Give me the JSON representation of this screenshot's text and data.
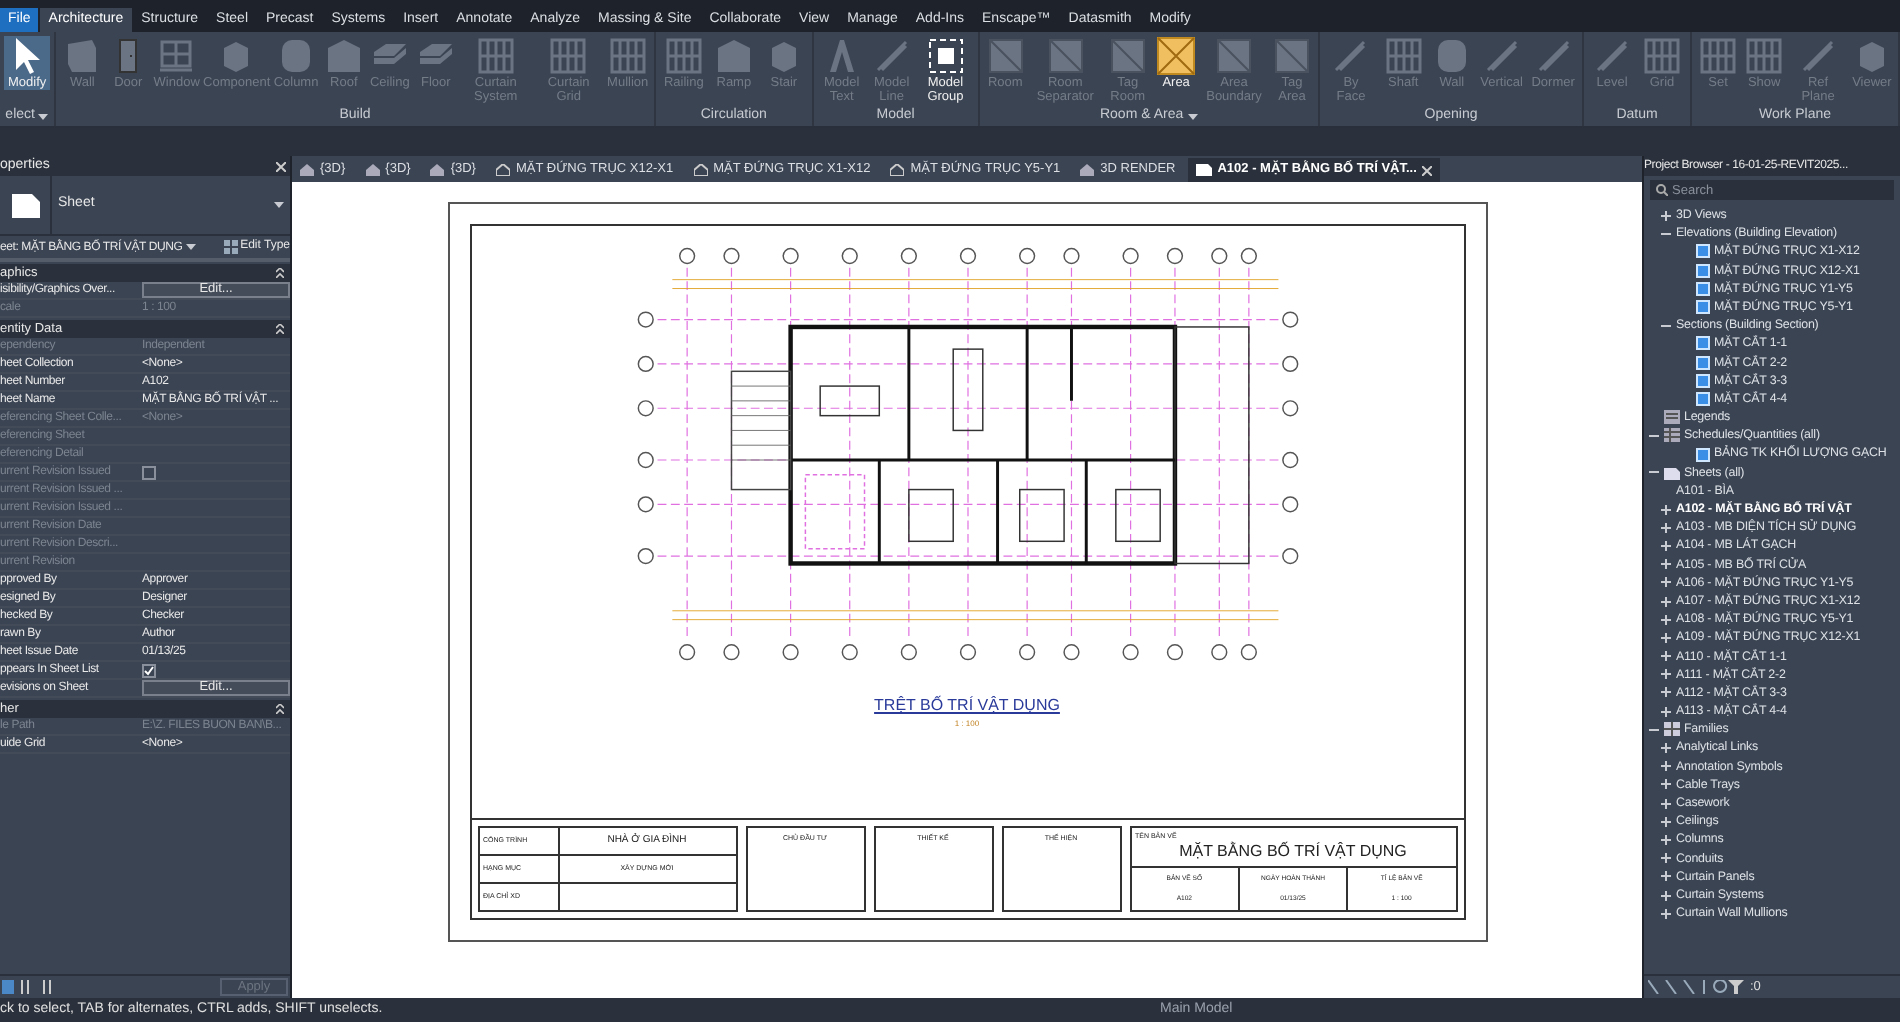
{
  "menu_tabs": [
    {
      "label": "File",
      "selected": false,
      "kind": "file"
    },
    {
      "label": "Architecture",
      "selected": true
    },
    {
      "label": "Structure",
      "selected": false
    },
    {
      "label": "Steel",
      "selected": false
    },
    {
      "label": "Precast",
      "selected": false
    },
    {
      "label": "Systems",
      "selected": false
    },
    {
      "label": "Insert",
      "selected": false
    },
    {
      "label": "Annotate",
      "selected": false
    },
    {
      "label": "Analyze",
      "selected": false
    },
    {
      "label": "Massing & Site",
      "selected": false
    },
    {
      "label": "Collaborate",
      "selected": false
    },
    {
      "label": "View",
      "selected": false
    },
    {
      "label": "Manage",
      "selected": false
    },
    {
      "label": "Add-Ins",
      "selected": false
    },
    {
      "label": "Enscape™",
      "selected": false
    },
    {
      "label": "Datasmith",
      "selected": false
    },
    {
      "label": "Modify",
      "selected": false
    }
  ],
  "ribbon_panels": [
    {
      "title": "elect",
      "dropdown": true,
      "tools": [
        {
          "label": "Modify",
          "disabled": false,
          "kind": "pointer",
          "selected": true
        }
      ]
    },
    {
      "title": "Build",
      "dropdown": false,
      "tools": [
        {
          "label": "Wall",
          "disabled": true,
          "kind": "wall"
        },
        {
          "label": "Door",
          "disabled": true,
          "kind": "door"
        },
        {
          "label": "Window",
          "disabled": true,
          "kind": "window"
        },
        {
          "label": "Component",
          "disabled": true,
          "kind": "box"
        },
        {
          "label": "Column",
          "disabled": true,
          "kind": "column"
        },
        {
          "label": "Roof",
          "disabled": true,
          "kind": "roof"
        },
        {
          "label": "Ceiling",
          "disabled": true,
          "kind": "slab"
        },
        {
          "label": "Floor",
          "disabled": true,
          "kind": "slab"
        },
        {
          "label": "Curtain System",
          "disabled": true,
          "kind": "grid"
        },
        {
          "label": "Curtain Grid",
          "disabled": true,
          "kind": "grid"
        },
        {
          "label": "Mullion",
          "disabled": true,
          "kind": "grid"
        }
      ]
    },
    {
      "title": "Circulation",
      "dropdown": false,
      "tools": [
        {
          "label": "Railing",
          "disabled": true,
          "kind": "grid"
        },
        {
          "label": "Ramp",
          "disabled": true,
          "kind": "roof"
        },
        {
          "label": "Stair",
          "disabled": true,
          "kind": "box"
        }
      ]
    },
    {
      "title": "Model",
      "dropdown": false,
      "tools": [
        {
          "label": "Model Text",
          "disabled": true,
          "kind": "letter"
        },
        {
          "label": "Model Line",
          "disabled": true,
          "kind": "line"
        },
        {
          "label": "Model Group",
          "disabled": false,
          "kind": "group"
        }
      ]
    },
    {
      "title": "Room & Area",
      "dropdown": true,
      "tools": [
        {
          "label": "Room",
          "disabled": true,
          "kind": "room"
        },
        {
          "label": "Room Separator",
          "disabled": true,
          "kind": "room"
        },
        {
          "label": "Tag Room",
          "disabled": true,
          "kind": "room"
        },
        {
          "label": "Area",
          "disabled": false,
          "kind": "area"
        },
        {
          "label": "Area Boundary",
          "disabled": true,
          "kind": "room"
        },
        {
          "label": "Tag Area",
          "disabled": true,
          "kind": "room"
        }
      ]
    },
    {
      "title": "Opening",
      "dropdown": false,
      "tools": [
        {
          "label": "By Face",
          "disabled": true,
          "kind": "line"
        },
        {
          "label": "Shaft",
          "disabled": true,
          "kind": "grid"
        },
        {
          "label": "Wall",
          "disabled": true,
          "kind": "column"
        },
        {
          "label": "Vertical",
          "disabled": true,
          "kind": "line"
        },
        {
          "label": "Dormer",
          "disabled": true,
          "kind": "line"
        }
      ]
    },
    {
      "title": "Datum",
      "dropdown": false,
      "tools": [
        {
          "label": "Level",
          "disabled": true,
          "kind": "line"
        },
        {
          "label": "Grid",
          "disabled": true,
          "kind": "grid"
        }
      ]
    },
    {
      "title": "Work Plane",
      "dropdown": false,
      "tools": [
        {
          "label": "Set",
          "disabled": true,
          "kind": "grid"
        },
        {
          "label": "Show",
          "disabled": true,
          "kind": "grid"
        },
        {
          "label": "Ref Plane",
          "disabled": true,
          "kind": "line"
        },
        {
          "label": "Viewer",
          "disabled": true,
          "kind": "box"
        }
      ]
    }
  ],
  "properties": {
    "title": "operties",
    "type_name": "Sheet",
    "selector": "eet: MẶT BẰNG BỐ TRÍ VẬT DỤNG",
    "edit_type": "Edit Type",
    "groups": [
      {
        "title": "aphics",
        "rows": [
          {
            "label": "isibility/Graphics Over...",
            "value": "Edit...",
            "kind": "button",
            "disabled": false
          },
          {
            "label": "cale",
            "value": "1 : 100",
            "kind": "text",
            "disabled": true
          }
        ]
      },
      {
        "title": "entity Data",
        "rows": [
          {
            "label": "ependency",
            "value": "Independent",
            "kind": "text",
            "disabled": true
          },
          {
            "label": "heet Collection",
            "value": "<None>",
            "kind": "text",
            "disabled": false
          },
          {
            "label": "heet Number",
            "value": "A102",
            "kind": "text",
            "disabled": false
          },
          {
            "label": "heet Name",
            "value": "MẶT BẰNG BỐ TRÍ VẬT ...",
            "kind": "text",
            "disabled": false
          },
          {
            "label": "eferencing Sheet Colle...",
            "value": "<None>",
            "kind": "text",
            "disabled": true
          },
          {
            "label": "eferencing Sheet",
            "kind": "text",
            "disabled": true
          },
          {
            "label": "eferencing Detail",
            "kind": "text",
            "disabled": true
          },
          {
            "label": "urrent Revision Issued",
            "kind": "checkbox",
            "checked": false,
            "disabled": true
          },
          {
            "label": "urrent Revision Issued ...",
            "kind": "text",
            "disabled": true
          },
          {
            "label": "urrent Revision Issued ...",
            "kind": "text",
            "disabled": true
          },
          {
            "label": "urrent Revision Date",
            "kind": "text",
            "disabled": true
          },
          {
            "label": "urrent Revision Descri...",
            "kind": "text",
            "disabled": true
          },
          {
            "label": "urrent Revision",
            "kind": "text",
            "disabled": true
          },
          {
            "label": "pproved By",
            "value": "Approver",
            "kind": "text",
            "disabled": false
          },
          {
            "label": "esigned By",
            "value": "Designer",
            "kind": "text",
            "disabled": false
          },
          {
            "label": "hecked By",
            "value": "Checker",
            "kind": "text",
            "disabled": false
          },
          {
            "label": "rawn By",
            "value": "Author",
            "kind": "text",
            "disabled": false
          },
          {
            "label": "heet Issue Date",
            "value": "01/13/25",
            "kind": "text",
            "disabled": false
          },
          {
            "label": "ppears In Sheet List",
            "kind": "checkbox",
            "checked": true,
            "disabled": false
          },
          {
            "label": "evisions on Sheet",
            "value": "Edit...",
            "kind": "button",
            "disabled": false
          }
        ]
      },
      {
        "title": "her",
        "rows": [
          {
            "label": "le Path",
            "value": "E:\\Z. FILES BUON BAN\\B...",
            "kind": "text",
            "disabled": true
          },
          {
            "label": "uide Grid",
            "value": "<None>",
            "kind": "text",
            "disabled": false
          }
        ]
      }
    ],
    "apply": {
      "label": "Apply",
      "disabled": true
    }
  },
  "view_tabs": [
    {
      "label": "{3D}",
      "selected": false,
      "kind": "model"
    },
    {
      "label": "{3D}",
      "selected": false,
      "kind": "model"
    },
    {
      "label": "{3D}",
      "selected": false,
      "kind": "model"
    },
    {
      "label": "MẶT ĐỨNG TRỤC X12-X1",
      "selected": false,
      "kind": "elevation"
    },
    {
      "label": "MẶT ĐỨNG TRỤC X1-X12",
      "selected": false,
      "kind": "elevation"
    },
    {
      "label": "MẶT ĐỨNG TRỤC Y5-Y1",
      "selected": false,
      "kind": "elevation"
    },
    {
      "label": "3D RENDER",
      "selected": false,
      "kind": "model"
    },
    {
      "label": "A102 - MẶT BẰNG BỐ TRÍ VẬT...",
      "selected": true,
      "kind": "sheet"
    }
  ],
  "sheet": {
    "view_title": "TRỆT BỐ TRÍ VẬT DỤNG",
    "view_scale": "1 : 100",
    "project_rows": [
      {
        "label": "CÔNG TRÌNH",
        "value": "NHÀ Ở GIA ĐÌNH"
      },
      {
        "label": "HẠNG MỤC",
        "value": "XÂY DỰNG MỚI"
      },
      {
        "label": "ĐỊA CHỈ XD"
      }
    ],
    "sign_boxes": [
      "CHỦ ĐẦU TƯ",
      "THIẾT KẾ",
      "THỂ HIỆN"
    ],
    "drawing_name_label": "TÊN BẢN VẼ",
    "drawing_name": "MẶT BẰNG BỐ TRÍ VẬT DỤNG",
    "info": [
      {
        "label": "BẢN VẼ SỐ",
        "value": "A102"
      },
      {
        "label": "NGÀY HOÀN THÀNH",
        "value": "01/13/25"
      },
      {
        "label": "TỈ LỆ BẢN VẼ",
        "value": "1 : 100"
      }
    ]
  },
  "project_browser": {
    "title": "Project Browser - 16-01-25-REVIT2025...",
    "search": {
      "placeholder": "Search"
    },
    "tree": [
      {
        "label": "3D Views",
        "expanded": false,
        "kind": "category"
      },
      {
        "label": "Elevations (Building Elevation)",
        "expanded": true,
        "kind": "category",
        "children": [
          {
            "label": "MẶT ĐỨNG TRỤC X1-X12",
            "kind": "view"
          },
          {
            "label": "MẶT ĐỨNG TRỤC X12-X1",
            "kind": "view"
          },
          {
            "label": "MẶT ĐỨNG TRỤC Y1-Y5",
            "kind": "view"
          },
          {
            "label": "MẶT ĐỨNG TRỤC Y5-Y1",
            "kind": "view"
          }
        ]
      },
      {
        "label": "Sections (Building Section)",
        "expanded": true,
        "kind": "category",
        "children": [
          {
            "label": "MẶT CẮT 1-1",
            "kind": "view"
          },
          {
            "label": "MẶT CẮT 2-2",
            "kind": "view"
          },
          {
            "label": "MẶT CẮT 3-3",
            "kind": "view"
          },
          {
            "label": "MẶT CẮT 4-4",
            "kind": "view"
          }
        ]
      },
      {
        "label": "Legends",
        "kind": "legend",
        "root": true
      },
      {
        "label": "Schedules/Quantities (all)",
        "expanded": true,
        "kind": "schedule",
        "root": true,
        "children": [
          {
            "label": "BẢNG TK KHỐI LƯỢNG GẠCH",
            "kind": "view"
          }
        ]
      },
      {
        "label": "Sheets (all)",
        "expanded": true,
        "kind": "sheets",
        "root": true,
        "children": [
          {
            "label": "A101 - BÌA",
            "kind": "sheet",
            "selected": false
          },
          {
            "label": "A102 - MẶT BẰNG BỐ TRÍ VẬT",
            "kind": "sheet",
            "expanded": false,
            "selected": true
          },
          {
            "label": "A103 - MB DIỆN TÍCH SỬ DỤNG",
            "kind": "sheet",
            "expanded": false,
            "selected": false
          },
          {
            "label": "A104 - MB LÁT GẠCH",
            "kind": "sheet",
            "expanded": false,
            "selected": false
          },
          {
            "label": "A105 - MB BỐ TRÍ CỬA",
            "kind": "sheet",
            "expanded": false,
            "selected": false
          },
          {
            "label": "A106 - MẶT ĐỨNG TRỤC Y1-Y5",
            "kind": "sheet",
            "expanded": false,
            "selected": false
          },
          {
            "label": "A107 - MẶT ĐỨNG TRỤC X1-X12",
            "kind": "sheet",
            "expanded": false,
            "selected": false
          },
          {
            "label": "A108 - MẶT ĐỨNG TRỤC Y5-Y1",
            "kind": "sheet",
            "expanded": false,
            "selected": false
          },
          {
            "label": "A109 - MẶT ĐỨNG TRỤC X12-X1",
            "kind": "sheet",
            "expanded": false,
            "selected": false
          },
          {
            "label": "A110 - MẶT CẮT 1-1",
            "kind": "sheet",
            "expanded": false,
            "selected": false
          },
          {
            "label": "A111 - MẶT CẮT 2-2",
            "kind": "sheet",
            "expanded": false,
            "selected": false
          },
          {
            "label": "A112 - MẶT CẮT 3-3",
            "kind": "sheet",
            "expanded": false,
            "selected": false
          },
          {
            "label": "A113 - MẶT CẮT 4-4",
            "kind": "sheet",
            "expanded": false,
            "selected": false
          }
        ]
      },
      {
        "label": "Families",
        "expanded": true,
        "kind": "families",
        "root": true,
        "children": [
          {
            "label": "Analytical Links",
            "expanded": false,
            "kind": "category"
          },
          {
            "label": "Annotation Symbols",
            "expanded": false,
            "kind": "category"
          },
          {
            "label": "Cable Trays",
            "expanded": false,
            "kind": "category"
          },
          {
            "label": "Casework",
            "expanded": false,
            "kind": "category"
          },
          {
            "label": "Ceilings",
            "expanded": false,
            "kind": "category"
          },
          {
            "label": "Columns",
            "expanded": false,
            "kind": "category"
          },
          {
            "label": "Conduits",
            "expanded": false,
            "kind": "category"
          },
          {
            "label": "Curtain Panels",
            "expanded": false,
            "kind": "category"
          },
          {
            "label": "Curtain Systems",
            "expanded": false,
            "kind": "category"
          },
          {
            "label": "Curtain Wall Mullions",
            "expanded": false,
            "kind": "category"
          }
        ]
      }
    ],
    "filter_count": ":0"
  },
  "status_bar": {
    "hint": "ck to select, TAB for alternates, CTRL adds, SHIFT unselects.",
    "model": "Main Model"
  }
}
